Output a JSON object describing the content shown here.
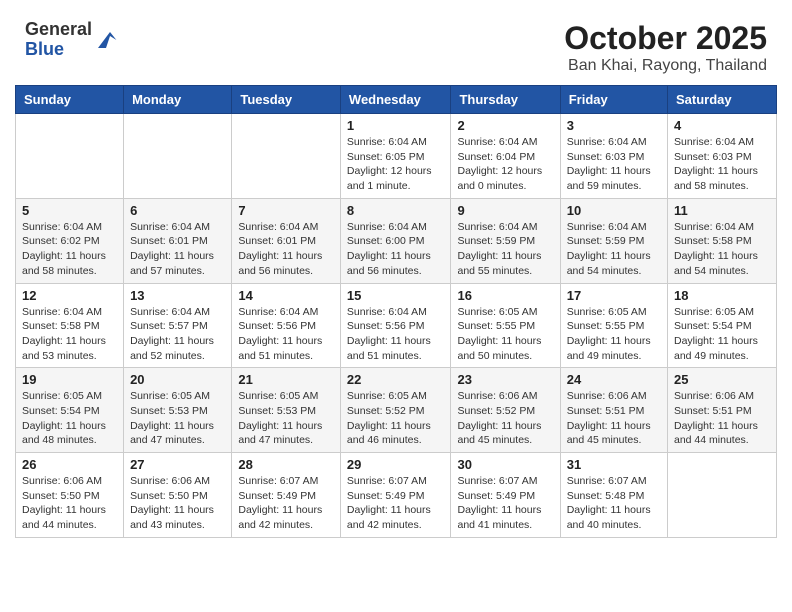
{
  "header": {
    "logo_general": "General",
    "logo_blue": "Blue",
    "title": "October 2025",
    "location": "Ban Khai, Rayong, Thailand"
  },
  "weekdays": [
    "Sunday",
    "Monday",
    "Tuesday",
    "Wednesday",
    "Thursday",
    "Friday",
    "Saturday"
  ],
  "weeks": [
    [
      {
        "day": "",
        "info": ""
      },
      {
        "day": "",
        "info": ""
      },
      {
        "day": "",
        "info": ""
      },
      {
        "day": "1",
        "info": "Sunrise: 6:04 AM\nSunset: 6:05 PM\nDaylight: 12 hours\nand 1 minute."
      },
      {
        "day": "2",
        "info": "Sunrise: 6:04 AM\nSunset: 6:04 PM\nDaylight: 12 hours\nand 0 minutes."
      },
      {
        "day": "3",
        "info": "Sunrise: 6:04 AM\nSunset: 6:03 PM\nDaylight: 11 hours\nand 59 minutes."
      },
      {
        "day": "4",
        "info": "Sunrise: 6:04 AM\nSunset: 6:03 PM\nDaylight: 11 hours\nand 58 minutes."
      }
    ],
    [
      {
        "day": "5",
        "info": "Sunrise: 6:04 AM\nSunset: 6:02 PM\nDaylight: 11 hours\nand 58 minutes."
      },
      {
        "day": "6",
        "info": "Sunrise: 6:04 AM\nSunset: 6:01 PM\nDaylight: 11 hours\nand 57 minutes."
      },
      {
        "day": "7",
        "info": "Sunrise: 6:04 AM\nSunset: 6:01 PM\nDaylight: 11 hours\nand 56 minutes."
      },
      {
        "day": "8",
        "info": "Sunrise: 6:04 AM\nSunset: 6:00 PM\nDaylight: 11 hours\nand 56 minutes."
      },
      {
        "day": "9",
        "info": "Sunrise: 6:04 AM\nSunset: 5:59 PM\nDaylight: 11 hours\nand 55 minutes."
      },
      {
        "day": "10",
        "info": "Sunrise: 6:04 AM\nSunset: 5:59 PM\nDaylight: 11 hours\nand 54 minutes."
      },
      {
        "day": "11",
        "info": "Sunrise: 6:04 AM\nSunset: 5:58 PM\nDaylight: 11 hours\nand 54 minutes."
      }
    ],
    [
      {
        "day": "12",
        "info": "Sunrise: 6:04 AM\nSunset: 5:58 PM\nDaylight: 11 hours\nand 53 minutes."
      },
      {
        "day": "13",
        "info": "Sunrise: 6:04 AM\nSunset: 5:57 PM\nDaylight: 11 hours\nand 52 minutes."
      },
      {
        "day": "14",
        "info": "Sunrise: 6:04 AM\nSunset: 5:56 PM\nDaylight: 11 hours\nand 51 minutes."
      },
      {
        "day": "15",
        "info": "Sunrise: 6:04 AM\nSunset: 5:56 PM\nDaylight: 11 hours\nand 51 minutes."
      },
      {
        "day": "16",
        "info": "Sunrise: 6:05 AM\nSunset: 5:55 PM\nDaylight: 11 hours\nand 50 minutes."
      },
      {
        "day": "17",
        "info": "Sunrise: 6:05 AM\nSunset: 5:55 PM\nDaylight: 11 hours\nand 49 minutes."
      },
      {
        "day": "18",
        "info": "Sunrise: 6:05 AM\nSunset: 5:54 PM\nDaylight: 11 hours\nand 49 minutes."
      }
    ],
    [
      {
        "day": "19",
        "info": "Sunrise: 6:05 AM\nSunset: 5:54 PM\nDaylight: 11 hours\nand 48 minutes."
      },
      {
        "day": "20",
        "info": "Sunrise: 6:05 AM\nSunset: 5:53 PM\nDaylight: 11 hours\nand 47 minutes."
      },
      {
        "day": "21",
        "info": "Sunrise: 6:05 AM\nSunset: 5:53 PM\nDaylight: 11 hours\nand 47 minutes."
      },
      {
        "day": "22",
        "info": "Sunrise: 6:05 AM\nSunset: 5:52 PM\nDaylight: 11 hours\nand 46 minutes."
      },
      {
        "day": "23",
        "info": "Sunrise: 6:06 AM\nSunset: 5:52 PM\nDaylight: 11 hours\nand 45 minutes."
      },
      {
        "day": "24",
        "info": "Sunrise: 6:06 AM\nSunset: 5:51 PM\nDaylight: 11 hours\nand 45 minutes."
      },
      {
        "day": "25",
        "info": "Sunrise: 6:06 AM\nSunset: 5:51 PM\nDaylight: 11 hours\nand 44 minutes."
      }
    ],
    [
      {
        "day": "26",
        "info": "Sunrise: 6:06 AM\nSunset: 5:50 PM\nDaylight: 11 hours\nand 44 minutes."
      },
      {
        "day": "27",
        "info": "Sunrise: 6:06 AM\nSunset: 5:50 PM\nDaylight: 11 hours\nand 43 minutes."
      },
      {
        "day": "28",
        "info": "Sunrise: 6:07 AM\nSunset: 5:49 PM\nDaylight: 11 hours\nand 42 minutes."
      },
      {
        "day": "29",
        "info": "Sunrise: 6:07 AM\nSunset: 5:49 PM\nDaylight: 11 hours\nand 42 minutes."
      },
      {
        "day": "30",
        "info": "Sunrise: 6:07 AM\nSunset: 5:49 PM\nDaylight: 11 hours\nand 41 minutes."
      },
      {
        "day": "31",
        "info": "Sunrise: 6:07 AM\nSunset: 5:48 PM\nDaylight: 11 hours\nand 40 minutes."
      },
      {
        "day": "",
        "info": ""
      }
    ]
  ]
}
